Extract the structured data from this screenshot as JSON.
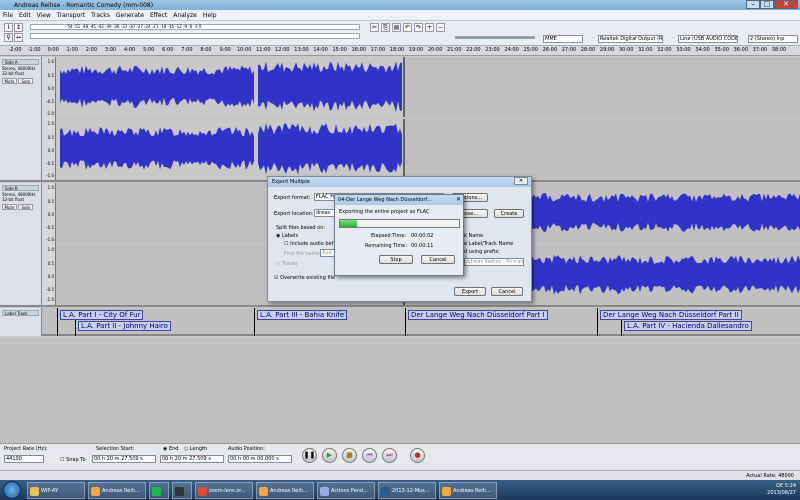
{
  "window": {
    "title": "Andreas Reihse - Romantic Comedy (mm-008)"
  },
  "menu": [
    "File",
    "Edit",
    "View",
    "Transport",
    "Tracks",
    "Generate",
    "Effect",
    "Analyze",
    "Help"
  ],
  "toolbar": {
    "meter_scale": "-54 -51 -48 -45 -42 -39 -36 -33 -30 -27 -24 -21 -18 -15 -12 -9 -6 -3 0",
    "host": "MME",
    "output_device": "Realtek Digital Output (R",
    "input_device": "Line (USB AUDIO  CODE)",
    "channels": "2 (Stereo) Inp"
  },
  "ruler": [
    "-2:00",
    "-1:00",
    "0:00",
    "1:00",
    "2:00",
    "3:00",
    "4:00",
    "5:00",
    "6:00",
    "7:00",
    "8:00",
    "9:00",
    "10:00",
    "11:00",
    "12:00",
    "13:00",
    "14:00",
    "15:00",
    "16:00",
    "17:00",
    "18:00",
    "19:00",
    "20:00",
    "21:00",
    "22:00",
    "23:00",
    "24:00",
    "25:00",
    "26:00",
    "27:00",
    "28:00",
    "29:00",
    "30:00",
    "31:00",
    "32:00",
    "33:00",
    "34:00",
    "35:00",
    "36:00",
    "37:00",
    "38:00"
  ],
  "tracks": [
    {
      "name": "Side A",
      "info": "Stereo, 48000Hz\n32-bit float",
      "mute": "Mute",
      "solo": "Solo"
    },
    {
      "name": "Side B",
      "info": "Stereo, 48000Hz\n32-bit float",
      "mute": "Mute",
      "solo": "Solo"
    }
  ],
  "scale": [
    "1.0",
    "0.5",
    "0.0",
    "-0.5",
    "-1.0"
  ],
  "label_track": {
    "name": "Label Track"
  },
  "labels": [
    {
      "text": "L.A. Part I - City Of Fur"
    },
    {
      "text": "L.A. Part II - Johnny Hairo"
    },
    {
      "text": "L.A. Part III - Bahia Knife"
    },
    {
      "text": "Der Lange Weg Nach Düsseldorf Part I"
    },
    {
      "text": "Der Lange Weg Nach Düsseldorf Part II"
    },
    {
      "text": "L.A. Part IV - Hacienda Dallesandro"
    }
  ],
  "export_dialog": {
    "title": "Export Multiple",
    "format_label": "Export format:",
    "format_value": "FLAC Files",
    "options_btn": "Options...",
    "location_label": "Export location:",
    "location_value": "dreas",
    "choose_btn": "oose...",
    "create_btn": "Create",
    "split_label": "Split files based on:",
    "labels_option": "Labels",
    "include_audio": "Include audio bef",
    "first_file": "First file name:",
    "first_file_value": "Aud",
    "tracks_option": "Tracks",
    "name_header": "k Name",
    "label_track_name": "e Label/Track Name",
    "num_prefix": "d using prefix:",
    "prefix_value": "ndreas Reihse - Roman",
    "overwrite": "Overwrite existing file",
    "export_btn": "Export",
    "cancel_btn": "Cancel"
  },
  "progress_dialog": {
    "title": "04-Der Lange Weg Nach Düsseldorf...",
    "message": "Exporting the entire project as FLAC",
    "progress": 0.14,
    "elapsed_label": "Elapsed Time:",
    "elapsed_value": "00:00:02",
    "remaining_label": "Remaining Time:",
    "remaining_value": "00:00:11",
    "stop_btn": "Stop",
    "cancel_btn": "Cancel"
  },
  "bottom": {
    "project_rate_label": "Project Rate (Hz):",
    "project_rate": "44100",
    "snap_to": "Snap To",
    "selection_start": "Selection Start:",
    "end_label": "End",
    "length_label": "Length",
    "audio_position": "Audio Position:",
    "sel_start_value": "00 h 20 m 27.509 s",
    "sel_end_value": "00 h 20 m 27.509 s",
    "audio_pos_value": "00 h 00 m 00.000 s",
    "actual_rate": "Actual Rate: 48000"
  },
  "transport": [
    {
      "name": "pause",
      "glyph": "❚❚"
    },
    {
      "name": "play",
      "glyph": "▶"
    },
    {
      "name": "stop",
      "glyph": "■"
    },
    {
      "name": "skip-start",
      "glyph": "⏮"
    },
    {
      "name": "skip-end",
      "glyph": "⏭"
    },
    {
      "name": "record",
      "glyph": "●"
    }
  ],
  "taskbar": {
    "items": [
      {
        "label": "WIP-AY",
        "color": "#e8c25a"
      },
      {
        "label": "Andreas Reih...",
        "color": "#f1a640"
      },
      {
        "label": "",
        "color": "#1db954"
      },
      {
        "label": "",
        "color": "#333333"
      },
      {
        "label": "zoom-lens.or...",
        "color": "#dd4b39"
      },
      {
        "label": "Andreas Reih...",
        "color": "#f1a640"
      },
      {
        "label": "Actions Pend...",
        "color": "#9ad"
      },
      {
        "label": "2013-12-Mus...",
        "color": "#2b5797"
      },
      {
        "label": "Andreas Reih...",
        "color": "#f1a640"
      }
    ],
    "lang": "DE",
    "time": "5:24",
    "date": "2013/08/27"
  },
  "colors": {
    "wave": "#3232c8",
    "wave_light": "#6464dc",
    "label_fill": "#c9d0ef"
  }
}
